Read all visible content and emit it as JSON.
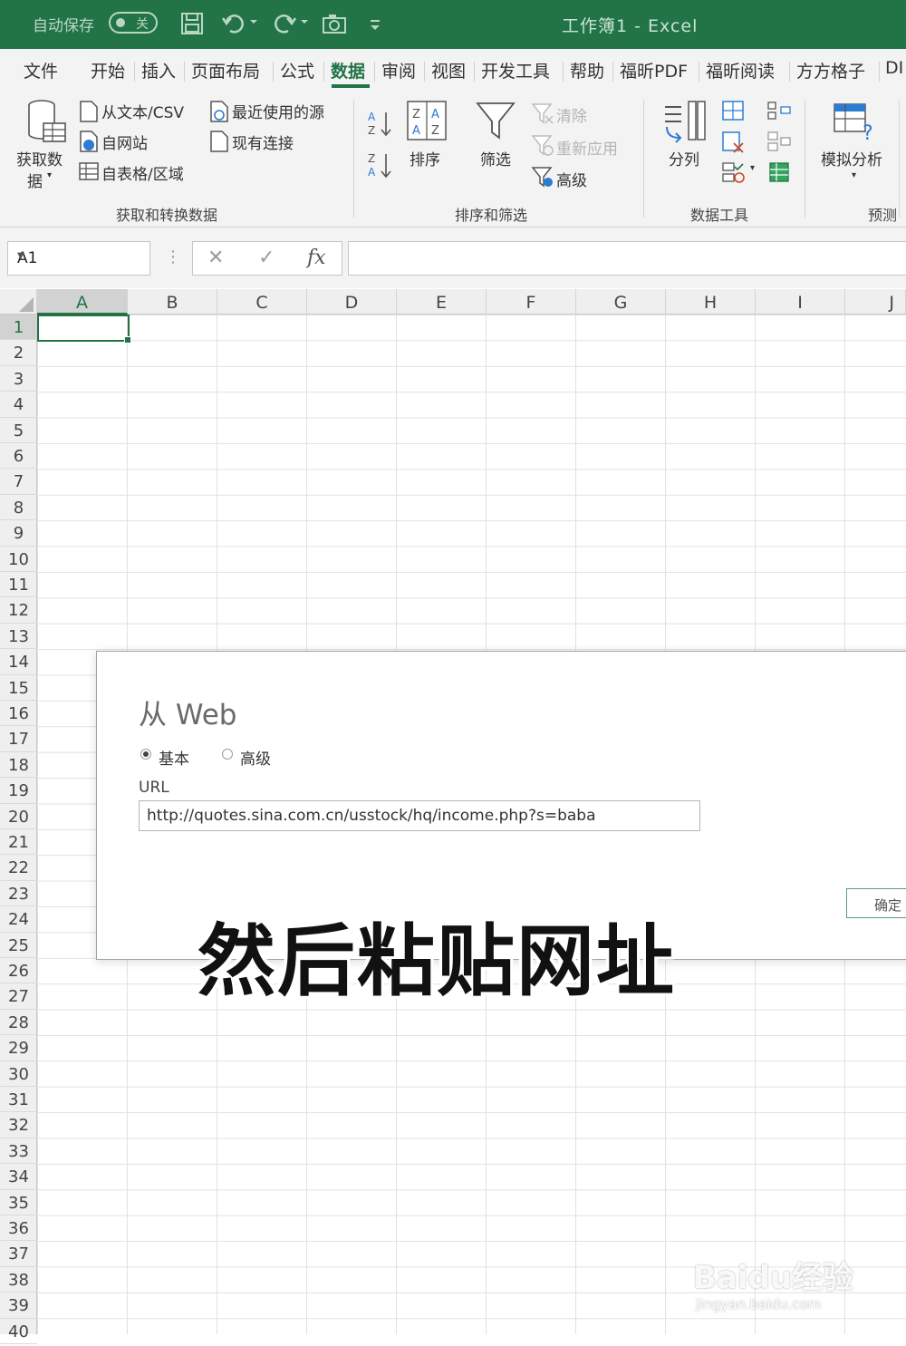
{
  "titlebar": {
    "autosave_label": "自动保存",
    "autosave_state": "关",
    "title": "工作簿1  -  Excel"
  },
  "tabs": [
    "文件",
    "开始",
    "插入",
    "页面布局",
    "公式",
    "数据",
    "审阅",
    "视图",
    "开发工具",
    "帮助",
    "福昕PDF",
    "福昕阅读",
    "方方格子",
    "DI"
  ],
  "active_tab": "数据",
  "ribbon": {
    "get_data": "获取数",
    "get_data_2": "据",
    "from_text_csv": "从文本/CSV",
    "from_web": "自网站",
    "from_table": "自表格/区域",
    "recent_sources": "最近使用的源",
    "existing_connections": "现有连接",
    "group_get_transform": "获取和转换数据",
    "sort": "排序",
    "filter": "筛选",
    "clear": "清除",
    "reapply": "重新应用",
    "advanced": "高级",
    "group_sort_filter": "排序和筛选",
    "text_to_columns": "分列",
    "group_data_tools": "数据工具",
    "what_if": "模拟分析",
    "group_forecast": "预测"
  },
  "formula_bar": {
    "name_box": "A1",
    "cancel_icon": "✕",
    "enter_icon": "✓",
    "fx_label": "fx",
    "formula": ""
  },
  "grid": {
    "columns": [
      "A",
      "B",
      "C",
      "D",
      "E",
      "F",
      "G",
      "H",
      "I",
      "J"
    ],
    "rows": [
      "1",
      "2",
      "3",
      "4",
      "5",
      "6",
      "7",
      "8",
      "9",
      "10",
      "11",
      "12",
      "13",
      "14",
      "15",
      "16",
      "17",
      "18",
      "19",
      "20",
      "21",
      "22",
      "23",
      "24",
      "25",
      "26",
      "27",
      "28",
      "29",
      "30",
      "31",
      "32",
      "33",
      "34",
      "35",
      "36",
      "37",
      "38",
      "39",
      "40"
    ],
    "selected_cell": "A1"
  },
  "dialog": {
    "title": "从 Web",
    "radio_basic": "基本",
    "radio_advanced": "高级",
    "selected_mode": "基本",
    "url_label": "URL",
    "url_value": "http://quotes.sina.com.cn/usstock/hq/income.php?s=baba",
    "ok_button": "确定"
  },
  "caption": "然后粘贴网址",
  "watermark": {
    "logo": "Baidu经验",
    "url": "jingyan.baidu.com"
  },
  "colors": {
    "excel_green": "#217346",
    "titlebar_bg": "#227447",
    "ribbon_bg": "#f3f3f3"
  }
}
